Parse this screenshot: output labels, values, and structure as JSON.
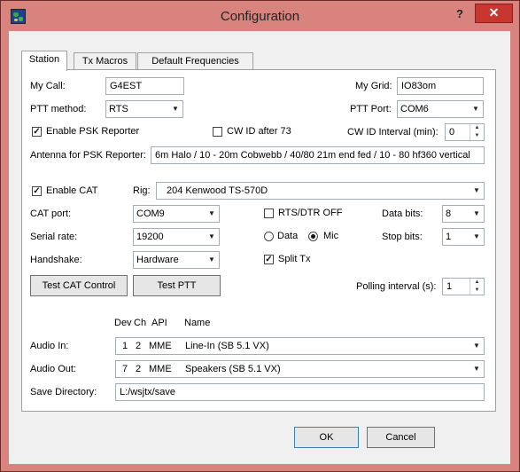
{
  "window": {
    "title": "Configuration",
    "help": "?",
    "close": "✕"
  },
  "tabs": [
    {
      "label": "Station"
    },
    {
      "label": "Tx Macros"
    },
    {
      "label": "Default Frequencies"
    }
  ],
  "station": {
    "my_call_label": "My Call:",
    "my_call_value": "G4EST",
    "my_grid_label": "My Grid:",
    "my_grid_value": "IO83om",
    "ptt_method_label": "PTT method:",
    "ptt_method_value": "RTS",
    "ptt_port_label": "PTT Port:",
    "ptt_port_value": "COM6",
    "enable_psk_label": "Enable PSK Reporter",
    "enable_psk_checked": true,
    "cw_id_after_label": "CW ID after 73",
    "cw_id_after_checked": false,
    "cw_id_interval_label": "CW ID Interval (min):",
    "cw_id_interval_value": "0",
    "antenna_label": "Antenna for PSK Reporter:",
    "antenna_value": "6m Halo / 10 - 20m Cobwebb / 40/80 21m end fed / 10 - 80 hf360 vertical",
    "enable_cat_label": "Enable CAT",
    "enable_cat_checked": true,
    "rig_label": "Rig:",
    "rig_value": "204  Kenwood  TS-570D",
    "cat_port_label": "CAT port:",
    "cat_port_value": "COM9",
    "rts_dtr_label": "RTS/DTR OFF",
    "rts_dtr_checked": false,
    "data_bits_label": "Data bits:",
    "data_bits_value": "8",
    "serial_rate_label": "Serial rate:",
    "serial_rate_value": "19200",
    "radio_data_label": "Data",
    "radio_mic_label": "Mic",
    "stop_bits_label": "Stop bits:",
    "stop_bits_value": "1",
    "handshake_label": "Handshake:",
    "handshake_value": "Hardware",
    "split_tx_label": "Split Tx",
    "split_tx_checked": true,
    "test_cat_button": "Test CAT Control",
    "test_ptt_button": "Test PTT",
    "polling_label": "Polling interval (s):",
    "polling_value": "1",
    "audio_headers": {
      "dev": "Dev",
      "ch": "Ch",
      "api": "API",
      "name": "Name"
    },
    "audio_in_label": "Audio In:",
    "audio_in": {
      "dev": "1",
      "ch": "2",
      "api": "MME",
      "name": "Line-In (SB 5.1 VX)"
    },
    "audio_out_label": "Audio Out:",
    "audio_out": {
      "dev": "7",
      "ch": "2",
      "api": "MME",
      "name": "Speakers (SB 5.1 VX)"
    },
    "save_dir_label": "Save Directory:",
    "save_dir_value": "L:/wsjtx/save"
  },
  "footer": {
    "ok": "OK",
    "cancel": "Cancel"
  },
  "colors": {
    "titlebar": "#d8837d",
    "close": "#c7372f",
    "dialog": "#f0f0f0"
  }
}
